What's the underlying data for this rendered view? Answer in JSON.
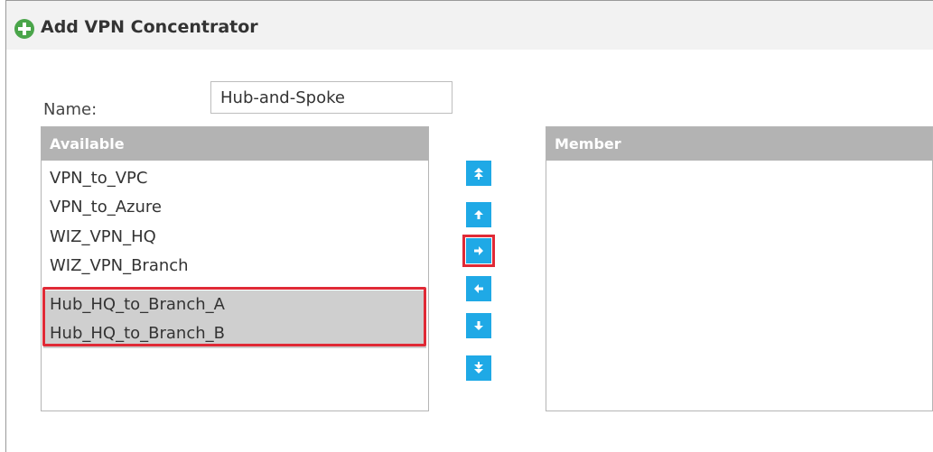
{
  "dialog": {
    "title": "Add VPN Concentrator",
    "title_icon": "add-circle-icon"
  },
  "form": {
    "name_label": "Name:",
    "name_value": "Hub-and-Spoke"
  },
  "available": {
    "header": "Available",
    "items": [
      {
        "label": "VPN_to_VPC",
        "selected": false
      },
      {
        "label": "VPN_to_Azure",
        "selected": false
      },
      {
        "label": "WIZ_VPN_HQ",
        "selected": false
      },
      {
        "label": "WIZ_VPN_Branch",
        "selected": false
      },
      {
        "label": "Hub_HQ_to_Branch_A",
        "selected": true
      },
      {
        "label": "Hub_HQ_to_Branch_B",
        "selected": true
      }
    ]
  },
  "member": {
    "header": "Member",
    "items": []
  },
  "controls": {
    "buttons": [
      {
        "icon": "double-arrow-up-icon",
        "action": "move to top"
      },
      {
        "icon": "arrow-up-icon",
        "action": "move up"
      },
      {
        "icon": "arrow-right-icon",
        "action": "add to member",
        "highlighted": true
      },
      {
        "icon": "arrow-left-icon",
        "action": "remove from member"
      },
      {
        "icon": "arrow-down-icon",
        "action": "move down"
      },
      {
        "icon": "double-arrow-down-icon",
        "action": "move to bottom"
      }
    ]
  },
  "colors": {
    "accent_button": "#1fa9e6",
    "highlight": "#e02a36",
    "header_gray": "#b3b3b3",
    "title_icon_green": "#4aa54a"
  }
}
